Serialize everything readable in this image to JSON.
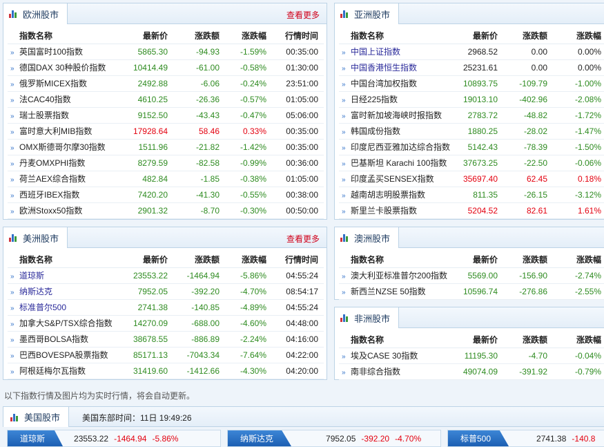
{
  "europe": {
    "title": "欧洲股市",
    "more": "查看更多",
    "headers": [
      "指数名称",
      "最新价",
      "涨跌额",
      "涨跌幅",
      "行情时间"
    ],
    "rows": [
      {
        "name": "英国富时100指数",
        "price": "5865.30",
        "change": "-94.93",
        "pct": "-1.59%",
        "time": "00:35:00"
      },
      {
        "name": "德国DAX 30种股价指数",
        "price": "10414.49",
        "change": "-61.00",
        "pct": "-0.58%",
        "time": "01:30:00"
      },
      {
        "name": "俄罗斯MICEX指数",
        "price": "2492.88",
        "change": "-6.06",
        "pct": "-0.24%",
        "time": "23:51:00"
      },
      {
        "name": "法CAC40指数",
        "price": "4610.25",
        "change": "-26.36",
        "pct": "-0.57%",
        "time": "01:05:00"
      },
      {
        "name": "瑞士股票指数",
        "price": "9152.50",
        "change": "-43.43",
        "pct": "-0.47%",
        "time": "05:06:00"
      },
      {
        "name": "富时意大利MIB指数",
        "price": "17928.64",
        "change": "58.46",
        "pct": "0.33%",
        "time": "00:35:00"
      },
      {
        "name": "OMX斯德哥尔摩30指数",
        "price": "1511.96",
        "change": "-21.82",
        "pct": "-1.42%",
        "time": "00:35:00"
      },
      {
        "name": "丹麦OMXPHI指数",
        "price": "8279.59",
        "change": "-82.58",
        "pct": "-0.99%",
        "time": "00:36:00"
      },
      {
        "name": "荷兰AEX综合指数",
        "price": "482.84",
        "change": "-1.85",
        "pct": "-0.38%",
        "time": "01:05:00"
      },
      {
        "name": "西班牙IBEX指数",
        "price": "7420.20",
        "change": "-41.30",
        "pct": "-0.55%",
        "time": "00:38:00"
      },
      {
        "name": "欧洲Stoxx50指数",
        "price": "2901.32",
        "change": "-8.70",
        "pct": "-0.30%",
        "time": "00:50:00"
      }
    ]
  },
  "asia": {
    "title": "亚洲股市",
    "headers": [
      "指数名称",
      "最新价",
      "涨跌额",
      "涨跌幅"
    ],
    "rows": [
      {
        "name": "中国上证指数",
        "price": "2968.52",
        "change": "0.00",
        "pct": "0.00%"
      },
      {
        "name": "中国香港恒生指数",
        "price": "25231.61",
        "change": "0.00",
        "pct": "0.00%"
      },
      {
        "name": "中国台湾加权指数",
        "price": "10893.75",
        "change": "-109.79",
        "pct": "-1.00%"
      },
      {
        "name": "日经225指数",
        "price": "19013.10",
        "change": "-402.96",
        "pct": "-2.08%"
      },
      {
        "name": "富时新加坡海峡时报指数",
        "price": "2783.72",
        "change": "-48.82",
        "pct": "-1.72%"
      },
      {
        "name": "韩国成份指数",
        "price": "1880.25",
        "change": "-28.02",
        "pct": "-1.47%"
      },
      {
        "name": "印度尼西亚雅加达综合指数",
        "price": "5142.43",
        "change": "-78.39",
        "pct": "-1.50%"
      },
      {
        "name": "巴基斯坦 Karachi 100指数",
        "price": "37673.25",
        "change": "-22.50",
        "pct": "-0.06%"
      },
      {
        "name": "印度孟买SENSEX指数",
        "price": "35697.40",
        "change": "62.45",
        "pct": "0.18%"
      },
      {
        "name": "越南胡志明股票指数",
        "price": "811.35",
        "change": "-26.15",
        "pct": "-3.12%"
      },
      {
        "name": "斯里兰卡股票指数",
        "price": "5204.52",
        "change": "82.61",
        "pct": "1.61%"
      }
    ]
  },
  "america": {
    "title": "美洲股市",
    "more": "查看更多",
    "headers": [
      "指数名称",
      "最新价",
      "涨跌额",
      "涨跌幅",
      "行情时间"
    ],
    "rows": [
      {
        "name": "道琼斯",
        "price": "23553.22",
        "change": "-1464.94",
        "pct": "-5.86%",
        "time": "04:55:24"
      },
      {
        "name": "纳斯达克",
        "price": "7952.05",
        "change": "-392.20",
        "pct": "-4.70%",
        "time": "08:54:17"
      },
      {
        "name": "标准普尔500",
        "price": "2741.38",
        "change": "-140.85",
        "pct": "-4.89%",
        "time": "04:55:24"
      },
      {
        "name": "加拿大S&P/TSX综合指数",
        "price": "14270.09",
        "change": "-688.00",
        "pct": "-4.60%",
        "time": "04:48:00"
      },
      {
        "name": "墨西哥BOLSA指数",
        "price": "38678.55",
        "change": "-886.89",
        "pct": "-2.24%",
        "time": "04:16:00"
      },
      {
        "name": "巴西BOVESPA股票指数",
        "price": "85171.13",
        "change": "-7043.34",
        "pct": "-7.64%",
        "time": "04:22:00"
      },
      {
        "name": "阿根廷梅尔瓦指数",
        "price": "31419.60",
        "change": "-1412.66",
        "pct": "-4.30%",
        "time": "04:20:00"
      }
    ]
  },
  "australia": {
    "title": "澳洲股市",
    "headers": [
      "指数名称",
      "最新价",
      "涨跌额",
      "涨跌幅"
    ],
    "rows": [
      {
        "name": "澳大利亚标准普尔200指数",
        "price": "5569.00",
        "change": "-156.90",
        "pct": "-2.74%"
      },
      {
        "name": "新西兰NZSE 50指数",
        "price": "10596.74",
        "change": "-276.86",
        "pct": "-2.55%"
      }
    ]
  },
  "africa": {
    "title": "非洲股市",
    "headers": [
      "指数名称",
      "最新价",
      "涨跌额",
      "涨跌幅"
    ],
    "rows": [
      {
        "name": "埃及CASE 30指数",
        "price": "11195.30",
        "change": "-4.70",
        "pct": "-0.04%"
      },
      {
        "name": "南非综合指数",
        "price": "49074.09",
        "change": "-391.92",
        "pct": "-0.79%"
      }
    ]
  },
  "notice": "以下指数行情及图片均为实时行情，将会自动更新。",
  "us_bar": {
    "title": "美国股市",
    "time_label": "美国东部时间：11日 19:49:26"
  },
  "tickers": [
    {
      "name": "道琼斯",
      "price": "23553.22",
      "change": "-1464.94",
      "pct": "-5.86%"
    },
    {
      "name": "纳斯达克",
      "price": "7952.05",
      "change": "-392.20",
      "pct": "-4.70%"
    },
    {
      "name": "标普500",
      "price": "2741.38",
      "change": "-140.8",
      "pct": ""
    }
  ],
  "colors": {
    "up": "#e3000f",
    "down": "#2e8b20",
    "more": "#d0021b",
    "accent": "#2f6fc8"
  }
}
